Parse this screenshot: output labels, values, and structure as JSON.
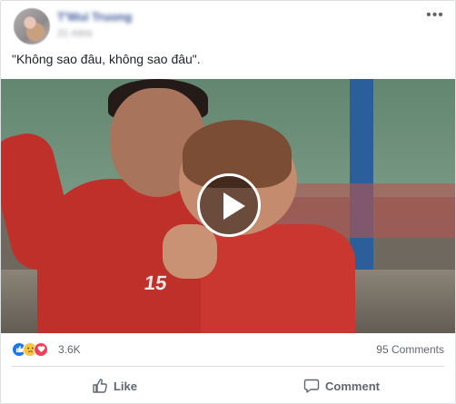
{
  "post": {
    "author": "T'Wui Truong",
    "time": "21 mins",
    "text": "\"Không sao đâu, không sao đâu\".",
    "more_label": "•••"
  },
  "video": {
    "jersey_number": "15",
    "play_icon": "play-icon"
  },
  "stats": {
    "reaction_icons": [
      "like-icon",
      "sad-icon",
      "love-icon"
    ],
    "reaction_count": "3.6K",
    "comments": "95 Comments"
  },
  "actions": {
    "like_label": "Like",
    "comment_label": "Comment"
  },
  "colors": {
    "link": "#385898",
    "like_blue": "#1877f2",
    "love_red": "#f33e58",
    "sad_yellow": "#f7c444",
    "muted_text": "#606770"
  }
}
